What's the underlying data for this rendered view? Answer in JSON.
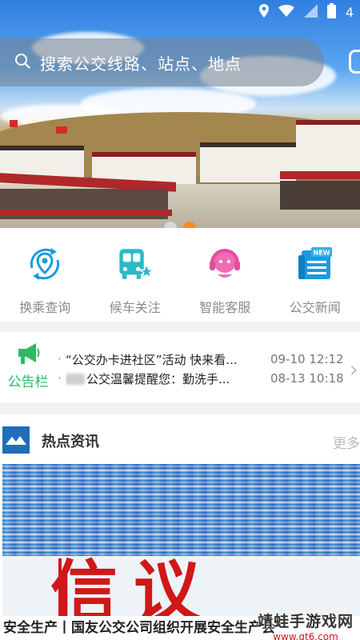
{
  "status_bar": {
    "battery_level_text": "4"
  },
  "search": {
    "placeholder": "搜索公交线路、站点、地点"
  },
  "banner": {
    "page_count": 2,
    "active_page": 2
  },
  "quick_entries": [
    {
      "label": "换乘查询",
      "icon": "transfer-location-icon"
    },
    {
      "label": "候车关注",
      "icon": "bus-star-icon"
    },
    {
      "label": "智能客服",
      "icon": "customer-service-icon"
    },
    {
      "label": "公交新闻",
      "icon": "news-icon"
    }
  ],
  "notice": {
    "label": "公告栏",
    "items": [
      {
        "text": "“公交办卡进社区”活动 快来看...",
        "time": "09-10 12:12"
      },
      {
        "text": "公交温馨提醒您：勤洗手...",
        "time": "08-13 10:18"
      }
    ]
  },
  "hot_news": {
    "title": "热点资讯",
    "more": "更多",
    "image_text": "信议",
    "caption": "安全生产丨国友公交公司组织开展安全生产会"
  },
  "watermark": {
    "line1": "靖蛙手游戏网",
    "line2": "www.qt6.com"
  },
  "colors": {
    "accent_orange": "#ff8a1e",
    "notice_green": "#2dbb63",
    "icon_blue": "#1a9be0",
    "news_red": "#d01818"
  }
}
